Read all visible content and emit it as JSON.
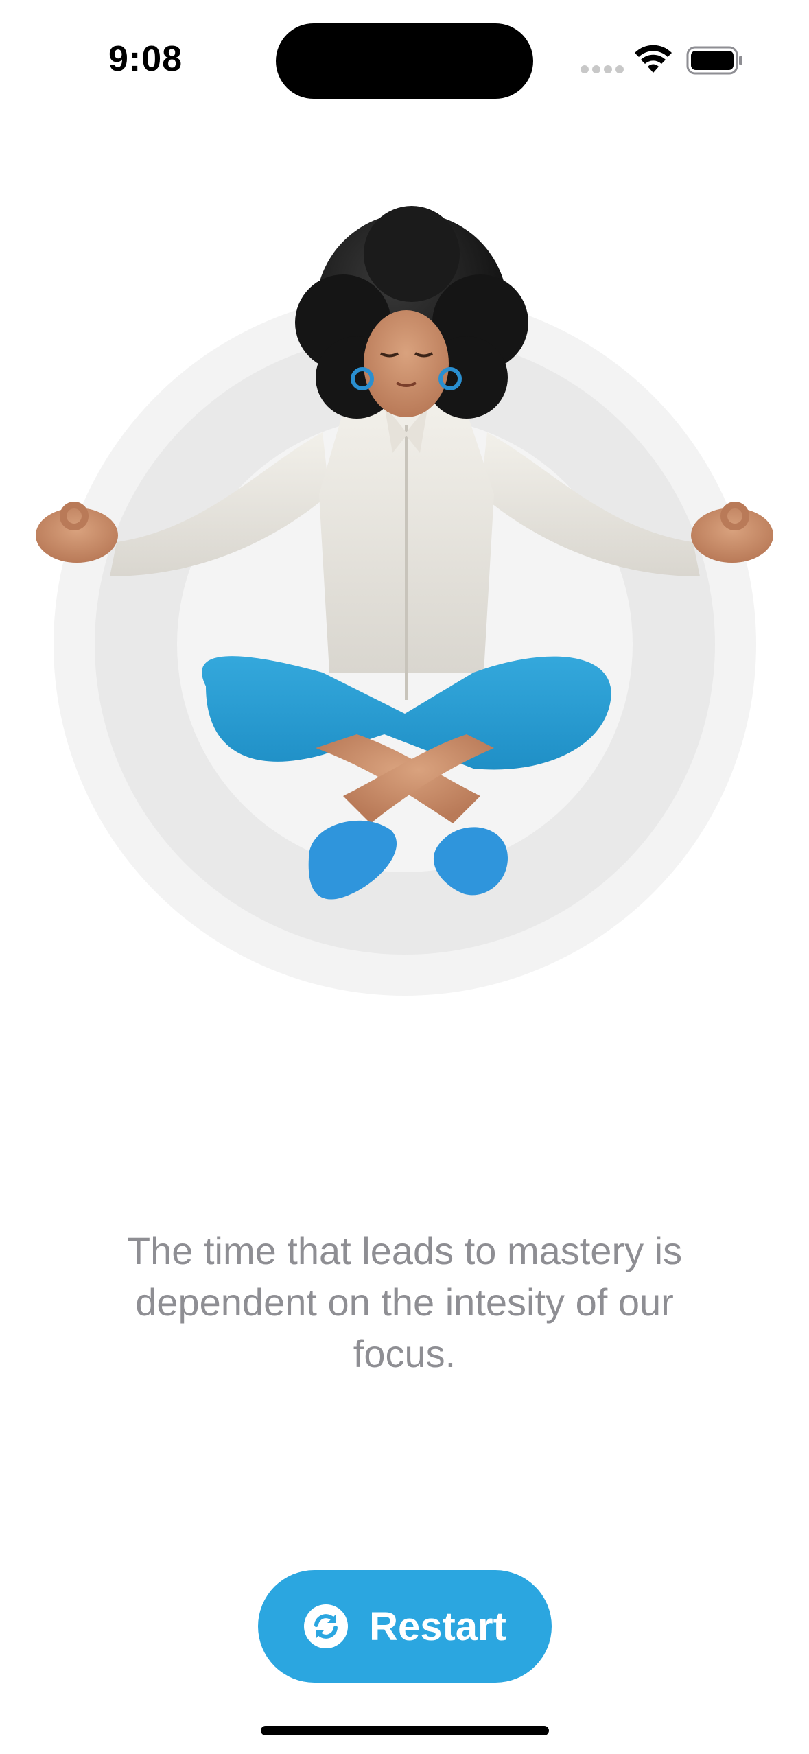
{
  "status_bar": {
    "time": "9:08",
    "icons": [
      "cellular-signal-icon",
      "wifi-icon",
      "battery-icon"
    ]
  },
  "illustration": {
    "subject": "meditating-person-illustration"
  },
  "quote": {
    "text": "The time that leads to mastery is dependent on the intesity of our focus."
  },
  "restart_button": {
    "label": "Restart",
    "icon": "refresh-icon",
    "color": "#2BA6E0"
  },
  "colors": {
    "background": "#FFFFFF",
    "quote_text": "#8E8E93",
    "ring_outer": "#F3F3F3",
    "ring_middle": "#E9E9E9",
    "ring_inner": "#F5F5F5"
  }
}
